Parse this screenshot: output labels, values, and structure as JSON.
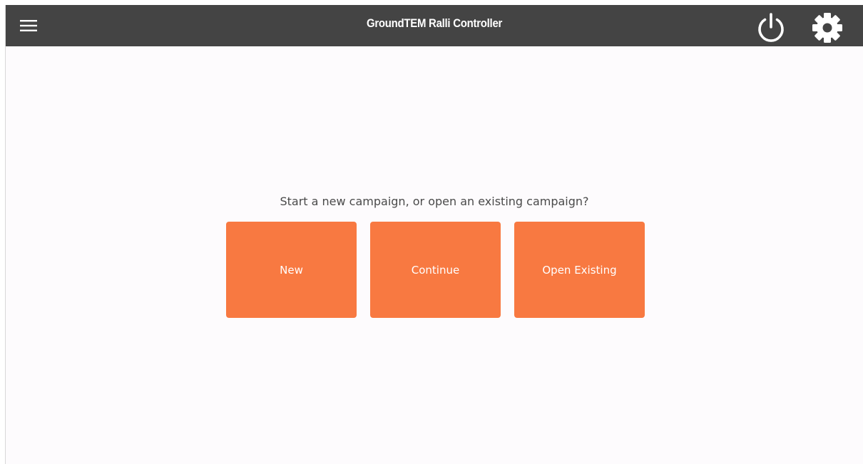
{
  "header": {
    "title": "GroundTEM Ralli Controller",
    "menu_icon": "hamburger-menu-icon",
    "power_icon": "power-icon",
    "settings_icon": "gear-icon"
  },
  "main": {
    "prompt": "Start a new campaign, or open an existing campaign?",
    "buttons": [
      {
        "label": "New"
      },
      {
        "label": "Continue"
      },
      {
        "label": "Open Existing"
      }
    ]
  },
  "colors": {
    "header_bg": "#444444",
    "accent": "#f87941",
    "page_bg": "#fdfbfd",
    "text": "#4a4a4a"
  }
}
